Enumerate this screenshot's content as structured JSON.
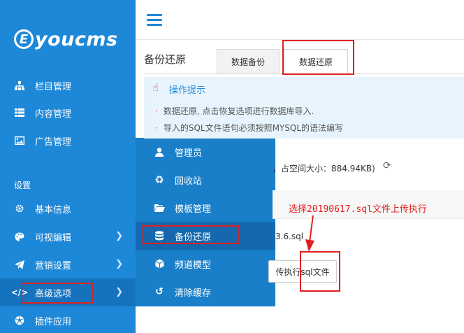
{
  "sidebar": {
    "logo_letter": "E",
    "logo_text": "youcms",
    "items": [
      {
        "label": "栏目管理",
        "icon": "sitemap-icon"
      },
      {
        "label": "内容管理",
        "icon": "list-icon"
      },
      {
        "label": "广告管理",
        "icon": "image-icon"
      }
    ],
    "settings_heading": "设置",
    "settings_items": [
      {
        "label": "基本信息",
        "icon": "gear-icon"
      },
      {
        "label": "可视编辑",
        "icon": "palette-icon"
      },
      {
        "label": "营销设置",
        "icon": "paper-plane-icon"
      },
      {
        "label": "高级选项",
        "icon": "code-icon"
      },
      {
        "label": "插件应用",
        "icon": "soccer-ball-icon"
      }
    ]
  },
  "submenu": {
    "items": [
      {
        "label": "管理员",
        "icon": "user-icon"
      },
      {
        "label": "回收站",
        "icon": "recycle-icon"
      },
      {
        "label": "模板管理",
        "icon": "folder-open-icon"
      },
      {
        "label": "备份还原",
        "icon": "database-icon"
      },
      {
        "label": "频道模型",
        "icon": "cube-icon"
      },
      {
        "label": "清除缓存",
        "icon": "undo-icon"
      }
    ]
  },
  "main": {
    "page_title": "备份还原",
    "tabs": [
      {
        "label": "数据备份"
      },
      {
        "label": "数据还原"
      }
    ],
    "tips": {
      "title": "操作提示",
      "lines": [
        "数据还原, 点击恢复选项进行数据库导入.",
        "导入的SQL文件语句必须按照MYSQL的语法编写"
      ]
    },
    "size_info": "，占空间大小：884.94KB)",
    "file_name_fragment": "3.6.sql",
    "upload_button": "传执行sql文件"
  },
  "annotation": {
    "text": "选择20190617.sql文件上传执行"
  },
  "colors": {
    "sidebar_bg": "#1e88d8",
    "submenu_bg": "#1a7fc9",
    "annotation_red": "#e02020",
    "tips_bg": "#e8f4fd"
  }
}
